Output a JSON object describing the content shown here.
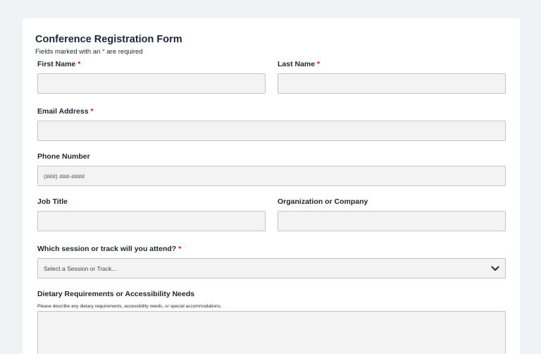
{
  "form": {
    "title": "Conference Registration Form",
    "required_note_prefix": "Fields marked with an ",
    "required_star": "*",
    "required_note_suffix": " are required",
    "fields": {
      "first_name": {
        "label": "First Name",
        "star": "*",
        "value": ""
      },
      "last_name": {
        "label": "Last Name",
        "star": "*",
        "value": ""
      },
      "email": {
        "label": "Email Address",
        "star": "*",
        "value": ""
      },
      "phone": {
        "label": "Phone Number",
        "placeholder": "(###) ###-####",
        "value": ""
      },
      "job_title": {
        "label": "Job Title",
        "value": ""
      },
      "organization": {
        "label": "Organization or Company",
        "value": ""
      },
      "session": {
        "label": "Which session or track will you attend?",
        "star": "*",
        "selected": "Select a Session or Track..."
      },
      "dietary": {
        "label": "Dietary Requirements or Accessibility Needs",
        "help": "Please describe any dietary requirements, accessibility needs, or special accommodations.",
        "value": ""
      }
    }
  },
  "icons": {
    "select_arrow": "chevron-down-icon"
  },
  "colors": {
    "required": "#d41a1a",
    "field_bg": "#f3f3f3",
    "page_bg": "#f0f3f6"
  }
}
